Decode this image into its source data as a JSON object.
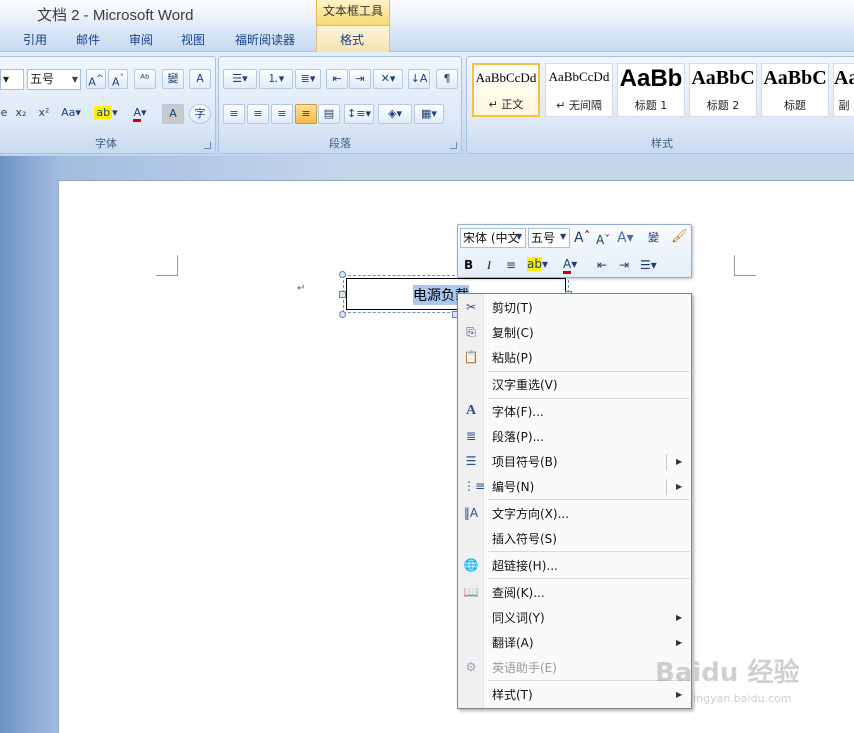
{
  "window": {
    "title": "文档 2 - Microsoft Word",
    "context_header": "文本框工具"
  },
  "tabs": [
    "引用",
    "邮件",
    "审阅",
    "视图",
    "福昕阅读器",
    "格式"
  ],
  "ribbon": {
    "font_group": {
      "label": "字体",
      "font_size": "五号"
    },
    "paragraph_group": {
      "label": "段落"
    },
    "styles_group": {
      "label": "样式",
      "items": [
        {
          "sample": "AaBbCcDd",
          "name": "↵ 正文"
        },
        {
          "sample": "AaBbCcDd",
          "name": "↵ 无间隔"
        },
        {
          "sample": "AaBb",
          "name": "标题 1"
        },
        {
          "sample": "AaBbC",
          "name": "标题 2"
        },
        {
          "sample": "AaBbC",
          "name": "标题"
        },
        {
          "sample": "Aa",
          "name": "副"
        }
      ]
    }
  },
  "document": {
    "paragraph_mark": "↵",
    "textbox_text": "电源负载"
  },
  "mini_toolbar": {
    "font": "宋体 (中文",
    "size": "五号"
  },
  "context_menu": {
    "items": [
      {
        "label": "剪切(T)",
        "icon": "scissors-icon"
      },
      {
        "label": "复制(C)",
        "icon": "copy-icon"
      },
      {
        "label": "粘贴(P)",
        "icon": "paste-icon"
      },
      {
        "label": "汉字重选(V)",
        "icon": ""
      },
      {
        "label": "字体(F)...",
        "icon": "font-icon"
      },
      {
        "label": "段落(P)...",
        "icon": "paragraph-icon"
      },
      {
        "label": "项目符号(B)",
        "icon": "bullets-icon"
      },
      {
        "label": "编号(N)",
        "icon": "numbering-icon"
      },
      {
        "label": "文字方向(X)...",
        "icon": "text-direction-icon"
      },
      {
        "label": "插入符号(S)",
        "icon": ""
      },
      {
        "label": "超链接(H)...",
        "icon": "hyperlink-icon"
      },
      {
        "label": "查阅(K)...",
        "icon": "research-icon"
      },
      {
        "label": "同义词(Y)",
        "icon": ""
      },
      {
        "label": "翻译(A)",
        "icon": ""
      },
      {
        "label": "英语助手(E)",
        "icon": "assistant-icon"
      },
      {
        "label": "样式(T)",
        "icon": ""
      }
    ]
  },
  "watermark": {
    "main": "Baidu 经验",
    "sub": "jingyan.baidu.com"
  }
}
